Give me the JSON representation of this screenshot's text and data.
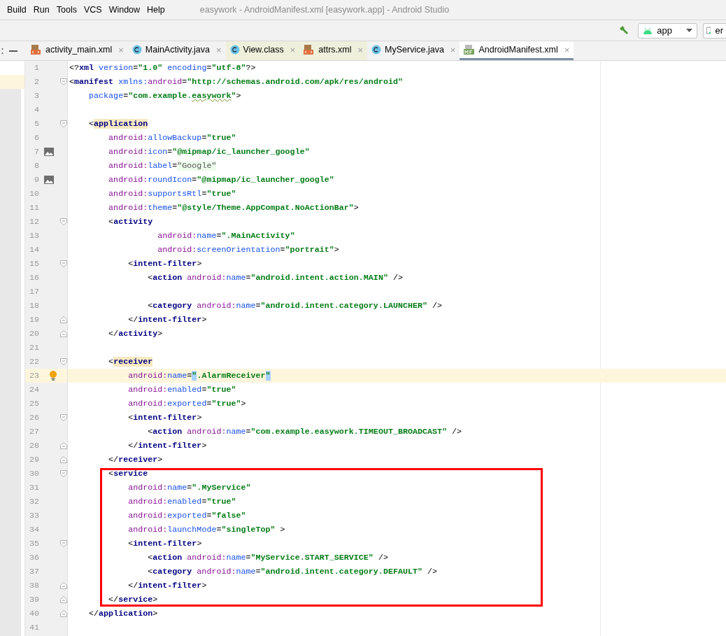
{
  "menu": [
    "Build",
    "Run",
    "Tools",
    "VCS",
    "Window",
    "Help"
  ],
  "window": {
    "title": "easywork - AndroidManifest.xml [easywork.app] - Android Studio"
  },
  "toolbar": {
    "run_config": "app",
    "device": "er"
  },
  "tabs": [
    {
      "label": "activity_main.xml",
      "kind": "xml",
      "close": "×",
      "readonly": false,
      "selected": false
    },
    {
      "label": "MainActivity.java",
      "kind": "class",
      "close": "×",
      "readonly": false,
      "selected": false
    },
    {
      "label": "View.class",
      "kind": "class",
      "close": "×",
      "readonly": true,
      "selected": false
    },
    {
      "label": "attrs.xml",
      "kind": "xml",
      "close": "×",
      "readonly": true,
      "selected": false
    },
    {
      "label": "MyService.java",
      "kind": "class",
      "close": "×",
      "readonly": false,
      "selected": false
    },
    {
      "label": "AndroidManifest.xml",
      "kind": "manifest",
      "close": "×",
      "readonly": false,
      "selected": true
    }
  ],
  "editor": {
    "lines": [
      {
        "number": "1",
        "current": false,
        "framed": false,
        "tokens": [
          {
            "kind": "p",
            "text": "<?"
          },
          {
            "kind": "t",
            "text": "xml "
          },
          {
            "kind": "a",
            "text": "version"
          },
          {
            "kind": "p",
            "text": "="
          },
          {
            "kind": "v",
            "text": "\"1.0\" "
          },
          {
            "kind": "a",
            "text": "encoding"
          },
          {
            "kind": "p",
            "text": "="
          },
          {
            "kind": "v",
            "text": "\"utf-8\""
          },
          {
            "kind": "p",
            "text": "?>"
          }
        ]
      },
      {
        "number": "2",
        "current": false,
        "framed": false,
        "fold": {
          "kind": "start"
        },
        "tokens": [
          {
            "kind": "p",
            "text": "<"
          },
          {
            "kind": "t",
            "text": "manifest "
          },
          {
            "kind": "a",
            "text": "xmlns:"
          },
          {
            "kind": "n",
            "text": "android"
          },
          {
            "kind": "p",
            "text": "="
          },
          {
            "kind": "v",
            "text": "\"http://schemas.android.com/apk/res/android\""
          }
        ]
      },
      {
        "number": "3",
        "current": false,
        "framed": false,
        "tokens": [
          {
            "kind": "a",
            "text": "    package"
          },
          {
            "kind": "p",
            "text": "="
          },
          {
            "kind": "v",
            "text": "\"com.example."
          },
          {
            "kind": "w",
            "text": "easywork"
          },
          {
            "kind": "v",
            "text": "\""
          },
          {
            "kind": "p",
            "text": ">"
          }
        ]
      },
      {
        "number": "4",
        "current": false,
        "framed": false
      },
      {
        "number": "5",
        "current": false,
        "framed": false,
        "fold": {
          "kind": "start"
        },
        "tokens": [
          {
            "kind": "p",
            "text": "    <"
          },
          {
            "kind": "m",
            "text": "application"
          }
        ]
      },
      {
        "number": "6",
        "current": false,
        "framed": false,
        "tokens": [
          {
            "kind": "n",
            "text": "        android:"
          },
          {
            "kind": "a",
            "text": "allowBackup"
          },
          {
            "kind": "p",
            "text": "="
          },
          {
            "kind": "v",
            "text": "\"true\""
          }
        ]
      },
      {
        "number": "7",
        "current": false,
        "framed": false,
        "gutter": {
          "kind": "image"
        },
        "tokens": [
          {
            "kind": "n",
            "text": "        android:"
          },
          {
            "kind": "a",
            "text": "icon"
          },
          {
            "kind": "p",
            "text": "="
          },
          {
            "kind": "v",
            "text": "\"@mipmap/ic_launcher_google\""
          }
        ]
      },
      {
        "number": "8",
        "current": false,
        "framed": false,
        "tokens": [
          {
            "kind": "n",
            "text": "        android:"
          },
          {
            "kind": "a",
            "text": "label"
          },
          {
            "kind": "p",
            "text": "="
          },
          {
            "kind": "g",
            "text": "\"Google\""
          }
        ]
      },
      {
        "number": "9",
        "current": false,
        "framed": false,
        "gutter": {
          "kind": "image"
        },
        "tokens": [
          {
            "kind": "n",
            "text": "        android:"
          },
          {
            "kind": "a",
            "text": "roundIcon"
          },
          {
            "kind": "p",
            "text": "="
          },
          {
            "kind": "v",
            "text": "\"@mipmap/ic_launcher_google\""
          }
        ]
      },
      {
        "number": "10",
        "current": false,
        "framed": false,
        "tokens": [
          {
            "kind": "n",
            "text": "        android:"
          },
          {
            "kind": "a",
            "text": "supportsRtl"
          },
          {
            "kind": "p",
            "text": "="
          },
          {
            "kind": "v",
            "text": "\"true\""
          }
        ]
      },
      {
        "number": "11",
        "current": false,
        "framed": false,
        "tokens": [
          {
            "kind": "n",
            "text": "        android:"
          },
          {
            "kind": "a",
            "text": "theme"
          },
          {
            "kind": "p",
            "text": "="
          },
          {
            "kind": "v",
            "text": "\"@style/Theme.AppCompat.NoActionBar\""
          },
          {
            "kind": "p",
            "text": ">"
          }
        ]
      },
      {
        "number": "12",
        "current": false,
        "framed": false,
        "fold": {
          "kind": "start"
        },
        "tokens": [
          {
            "kind": "p",
            "text": "        <"
          },
          {
            "kind": "t",
            "text": "activity"
          }
        ]
      },
      {
        "number": "13",
        "current": false,
        "framed": false,
        "tokens": [
          {
            "kind": "n",
            "text": "                  android:"
          },
          {
            "kind": "a",
            "text": "name"
          },
          {
            "kind": "p",
            "text": "="
          },
          {
            "kind": "v",
            "text": "\".MainActivity\""
          }
        ]
      },
      {
        "number": "14",
        "current": false,
        "framed": false,
        "tokens": [
          {
            "kind": "n",
            "text": "                  android:"
          },
          {
            "kind": "a",
            "text": "screenOrientation"
          },
          {
            "kind": "p",
            "text": "="
          },
          {
            "kind": "v",
            "text": "\"portrait\""
          },
          {
            "kind": "p",
            "text": ">"
          }
        ]
      },
      {
        "number": "15",
        "current": false,
        "framed": false,
        "fold": {
          "kind": "start"
        },
        "tokens": [
          {
            "kind": "p",
            "text": "            <"
          },
          {
            "kind": "t",
            "text": "intent-filter"
          },
          {
            "kind": "p",
            "text": ">"
          }
        ]
      },
      {
        "number": "16",
        "current": false,
        "framed": false,
        "tokens": [
          {
            "kind": "p",
            "text": "                <"
          },
          {
            "kind": "t",
            "text": "action "
          },
          {
            "kind": "n",
            "text": "android:"
          },
          {
            "kind": "a",
            "text": "name"
          },
          {
            "kind": "p",
            "text": "="
          },
          {
            "kind": "v",
            "text": "\"android.intent.action.MAIN\""
          },
          {
            "kind": "p",
            "text": " />"
          }
        ]
      },
      {
        "number": "17",
        "current": false,
        "framed": false
      },
      {
        "number": "18",
        "current": false,
        "framed": false,
        "tokens": [
          {
            "kind": "p",
            "text": "                <"
          },
          {
            "kind": "t",
            "text": "category "
          },
          {
            "kind": "n",
            "text": "android:"
          },
          {
            "kind": "a",
            "text": "name"
          },
          {
            "kind": "p",
            "text": "="
          },
          {
            "kind": "v",
            "text": "\"android.intent.category.LAUNCHER\""
          },
          {
            "kind": "p",
            "text": " />"
          }
        ]
      },
      {
        "number": "19",
        "current": false,
        "framed": false,
        "fold": {
          "kind": "end"
        },
        "tokens": [
          {
            "kind": "p",
            "text": "            </"
          },
          {
            "kind": "t",
            "text": "intent-filter"
          },
          {
            "kind": "p",
            "text": ">"
          }
        ]
      },
      {
        "number": "20",
        "current": false,
        "framed": false,
        "fold": {
          "kind": "end"
        },
        "tokens": [
          {
            "kind": "p",
            "text": "        </"
          },
          {
            "kind": "t",
            "text": "activity"
          },
          {
            "kind": "p",
            "text": ">"
          }
        ]
      },
      {
        "number": "21",
        "current": false,
        "framed": false
      },
      {
        "number": "22",
        "current": false,
        "framed": false,
        "fold": {
          "kind": "start"
        },
        "tokens": [
          {
            "kind": "p",
            "text": "        <"
          },
          {
            "kind": "m",
            "text": "receiver"
          }
        ]
      },
      {
        "number": "23",
        "current": true,
        "framed": false,
        "gutter": {
          "kind": "bulb"
        },
        "tokens": [
          {
            "kind": "n",
            "text": "            android:"
          },
          {
            "kind": "a",
            "text": "name"
          },
          {
            "kind": "p",
            "text": "="
          },
          {
            "kind": "q",
            "text": "\""
          },
          {
            "kind": "v",
            "text": ".AlarmReceiver"
          },
          {
            "kind": "q",
            "text": "\""
          }
        ]
      },
      {
        "number": "24",
        "current": false,
        "framed": false,
        "tokens": [
          {
            "kind": "n",
            "text": "            android:"
          },
          {
            "kind": "a",
            "text": "enabled"
          },
          {
            "kind": "p",
            "text": "="
          },
          {
            "kind": "v",
            "text": "\"true\""
          }
        ]
      },
      {
        "number": "25",
        "current": false,
        "framed": false,
        "tokens": [
          {
            "kind": "n",
            "text": "            android:"
          },
          {
            "kind": "a",
            "text": "exported"
          },
          {
            "kind": "p",
            "text": "="
          },
          {
            "kind": "v",
            "text": "\"true\""
          },
          {
            "kind": "p",
            "text": ">"
          }
        ]
      },
      {
        "number": "26",
        "current": false,
        "framed": false,
        "fold": {
          "kind": "start"
        },
        "tokens": [
          {
            "kind": "p",
            "text": "            <"
          },
          {
            "kind": "t",
            "text": "intent-filter"
          },
          {
            "kind": "p",
            "text": ">"
          }
        ]
      },
      {
        "number": "27",
        "current": false,
        "framed": false,
        "tokens": [
          {
            "kind": "p",
            "text": "                <"
          },
          {
            "kind": "t",
            "text": "action "
          },
          {
            "kind": "n",
            "text": "android:"
          },
          {
            "kind": "a",
            "text": "name"
          },
          {
            "kind": "p",
            "text": "="
          },
          {
            "kind": "v",
            "text": "\"com.example.easywork.TIMEOUT_BROADCAST\""
          },
          {
            "kind": "p",
            "text": " />"
          }
        ]
      },
      {
        "number": "28",
        "current": false,
        "framed": false,
        "fold": {
          "kind": "end"
        },
        "tokens": [
          {
            "kind": "p",
            "text": "            </"
          },
          {
            "kind": "t",
            "text": "intent-filter"
          },
          {
            "kind": "p",
            "text": ">"
          }
        ]
      },
      {
        "number": "29",
        "current": false,
        "framed": false,
        "fold": {
          "kind": "end"
        },
        "tokens": [
          {
            "kind": "p",
            "text": "        </"
          },
          {
            "kind": "t",
            "text": "receiver"
          },
          {
            "kind": "p",
            "text": ">"
          }
        ]
      },
      {
        "number": "30",
        "current": false,
        "framed": true,
        "fold": {
          "kind": "start"
        },
        "tokens": [
          {
            "kind": "p",
            "text": "        <"
          },
          {
            "kind": "t",
            "text": "service"
          }
        ]
      },
      {
        "number": "31",
        "current": false,
        "framed": true,
        "tokens": [
          {
            "kind": "n",
            "text": "            android:"
          },
          {
            "kind": "a",
            "text": "name"
          },
          {
            "kind": "p",
            "text": "="
          },
          {
            "kind": "v",
            "text": "\".MyService\""
          }
        ]
      },
      {
        "number": "32",
        "current": false,
        "framed": true,
        "tokens": [
          {
            "kind": "n",
            "text": "            android:"
          },
          {
            "kind": "a",
            "text": "enabled"
          },
          {
            "kind": "p",
            "text": "="
          },
          {
            "kind": "v",
            "text": "\"true\""
          }
        ]
      },
      {
        "number": "33",
        "current": false,
        "framed": true,
        "tokens": [
          {
            "kind": "n",
            "text": "            android:"
          },
          {
            "kind": "a",
            "text": "exported"
          },
          {
            "kind": "p",
            "text": "="
          },
          {
            "kind": "v",
            "text": "\"false\""
          }
        ]
      },
      {
        "number": "34",
        "current": false,
        "framed": true,
        "tokens": [
          {
            "kind": "n",
            "text": "            android:"
          },
          {
            "kind": "a",
            "text": "launchMode"
          },
          {
            "kind": "p",
            "text": "="
          },
          {
            "kind": "v",
            "text": "\"singleTop\""
          },
          {
            "kind": "p",
            "text": " >"
          }
        ]
      },
      {
        "number": "35",
        "current": false,
        "framed": true,
        "fold": {
          "kind": "start"
        },
        "tokens": [
          {
            "kind": "p",
            "text": "            <"
          },
          {
            "kind": "t",
            "text": "intent-filter"
          },
          {
            "kind": "p",
            "text": ">"
          }
        ]
      },
      {
        "number": "36",
        "current": false,
        "framed": true,
        "tokens": [
          {
            "kind": "p",
            "text": "                <"
          },
          {
            "kind": "t",
            "text": "action "
          },
          {
            "kind": "n",
            "text": "android:"
          },
          {
            "kind": "a",
            "text": "name"
          },
          {
            "kind": "p",
            "text": "="
          },
          {
            "kind": "v",
            "text": "\"MyService.START_SERVICE\""
          },
          {
            "kind": "p",
            "text": " />"
          }
        ]
      },
      {
        "number": "37",
        "current": false,
        "framed": true,
        "tokens": [
          {
            "kind": "p",
            "text": "                <"
          },
          {
            "kind": "t",
            "text": "category "
          },
          {
            "kind": "n",
            "text": "android:"
          },
          {
            "kind": "a",
            "text": "name"
          },
          {
            "kind": "p",
            "text": "="
          },
          {
            "kind": "v",
            "text": "\"android.intent.category.DEFAULT\""
          },
          {
            "kind": "p",
            "text": " />"
          }
        ]
      },
      {
        "number": "38",
        "current": false,
        "framed": true,
        "fold": {
          "kind": "end"
        },
        "tokens": [
          {
            "kind": "p",
            "text": "            </"
          },
          {
            "kind": "t",
            "text": "intent-filter"
          },
          {
            "kind": "p",
            "text": ">"
          }
        ]
      },
      {
        "number": "39",
        "current": false,
        "framed": true,
        "fold": {
          "kind": "end"
        },
        "tokens": [
          {
            "kind": "p",
            "text": "        </"
          },
          {
            "kind": "t",
            "text": "service"
          },
          {
            "kind": "p",
            "text": ">"
          }
        ]
      },
      {
        "number": "40",
        "current": false,
        "framed": false,
        "fold": {
          "kind": "end"
        },
        "tokens": [
          {
            "kind": "p",
            "text": "    </"
          },
          {
            "kind": "t",
            "text": "application"
          },
          {
            "kind": "p",
            "text": ">"
          }
        ]
      },
      {
        "number": "41",
        "current": false,
        "framed": false
      }
    ]
  }
}
